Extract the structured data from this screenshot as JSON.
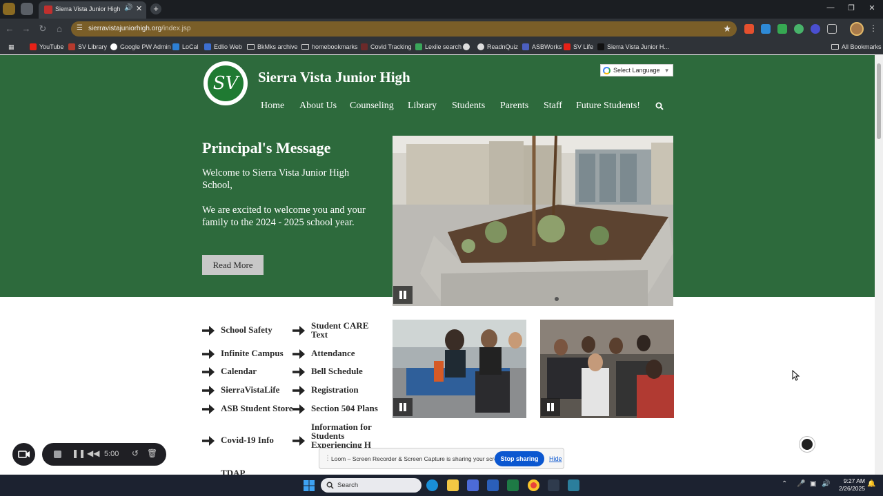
{
  "browser": {
    "tab_title": "Sierra Vista Junior High",
    "url_host": "sierravistajuniorhigh.org",
    "url_path": "/index.jsp",
    "bookmarks": [
      "YouTube",
      "SV Library",
      "Google PW Admin",
      "LoCal",
      "Edlio Web",
      "BkMks archive",
      "homebookmarks",
      "Covid Tracking",
      "Lexile search",
      "ReadnQuiz",
      "ASBWorks",
      "SV Life",
      "Sierra Vista Junior H..."
    ],
    "all_bookmarks": "All Bookmarks"
  },
  "site": {
    "title": "Sierra Vista Junior High",
    "logo_text": "SV",
    "language_select": "Select Language",
    "nav": [
      "Home",
      "About Us",
      "Counseling",
      "Library",
      "Students",
      "Parents",
      "Staff",
      "Future Students!"
    ]
  },
  "hero": {
    "heading": "Principal's Message",
    "paragraph1": "Welcome to Sierra Vista Junior High School,",
    "paragraph2": "We are excited to welcome you and your family to the 2024 - 2025 school year.",
    "button": "Read More"
  },
  "quick_links": {
    "left": [
      "School Safety",
      "Infinite Campus",
      "Calendar",
      "SierraVistaLife",
      "ASB Student Store",
      "Covid-19 Info"
    ],
    "right": [
      "Student CARE Text",
      "Attendance",
      "Bell Schedule",
      "Registration",
      "Section 504 Plans",
      "Information for Students Experiencing H"
    ],
    "partial_below": "TDAP"
  },
  "recorder": {
    "time": "5:00"
  },
  "share_bar": {
    "message": "Loom – Screen Recorder & Screen Capture is sharing your screen.",
    "stop": "Stop sharing",
    "hide": "Hide"
  },
  "taskbar": {
    "search": "Search",
    "time": "9:27 AM",
    "date": "2/26/2025"
  },
  "colors": {
    "hero_green": "#2d6a3c",
    "omnibox": "#7a5e28",
    "stop_sharing_blue": "#0b57d0"
  }
}
